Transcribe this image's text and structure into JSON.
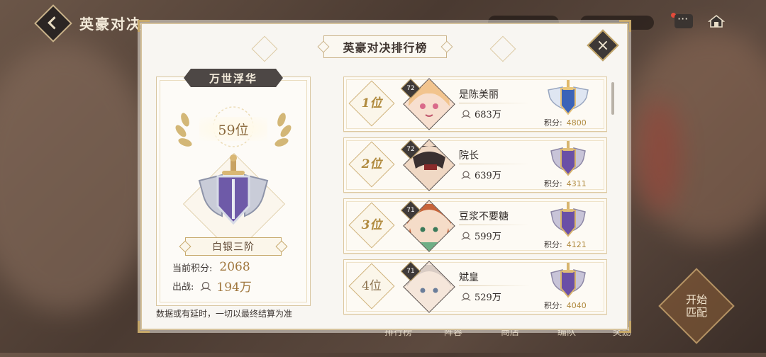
{
  "header": {
    "title": "英豪对决"
  },
  "panel": {
    "title": "英豪对决排行榜",
    "close_icon": "×"
  },
  "my_rank": {
    "season": "万世浮华",
    "rank": "59位",
    "tier": "白银三阶",
    "score_label": "当前积分:",
    "score": "2068",
    "power_label": "出战:",
    "power": "194万"
  },
  "note": "数据或有延时，一切以最终结算为准",
  "leaderboard": [
    {
      "rank": "1位",
      "level": "72",
      "name": "是陈美丽",
      "power": "683万",
      "score_label": "积分:",
      "score": "4800",
      "medal": "gold"
    },
    {
      "rank": "2位",
      "level": "72",
      "name": "院长",
      "power": "639万",
      "score_label": "积分:",
      "score": "4311",
      "medal": "purple"
    },
    {
      "rank": "3位",
      "level": "71",
      "name": "豆浆不要糖",
      "power": "599万",
      "score_label": "积分:",
      "score": "4121",
      "medal": "purple"
    },
    {
      "rank": "4位",
      "level": "71",
      "name": "斌皇",
      "power": "529万",
      "score_label": "积分:",
      "score": "4040",
      "medal": "purple"
    }
  ],
  "start_button": "开始\n匹配",
  "colors": {
    "accent_gold": "#c6a86a",
    "score_gold": "#b08a3d",
    "panel_bg": "#f8f6f2",
    "dark_plate": "#4d4745"
  }
}
